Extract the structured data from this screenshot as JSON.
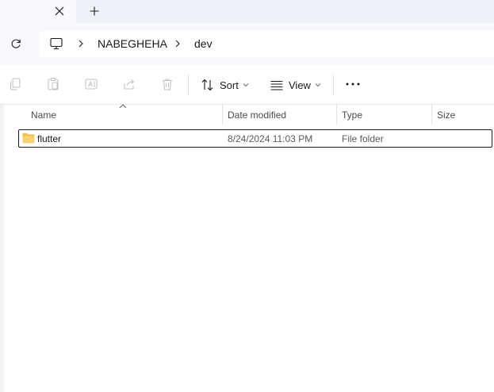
{
  "tabbar": {
    "close_icon": "close-icon",
    "new_tab_icon": "plus-icon"
  },
  "address": {
    "refresh_icon": "refresh-icon",
    "location_icon": "this-pc-icon",
    "breadcrumbs": [
      "NABEGHEHA",
      "dev"
    ]
  },
  "toolbar": {
    "icons": [
      "copy-icon",
      "paste-icon",
      "rename-icon",
      "share-icon",
      "delete-icon"
    ],
    "sort_label": "Sort",
    "view_label": "View",
    "more_icon": "more-icon"
  },
  "columns": {
    "name": "Name",
    "date": "Date modified",
    "type": "Type",
    "size": "Size"
  },
  "files": [
    {
      "name": "flutter",
      "date": "8/24/2024 11:03 PM",
      "type": "File folder",
      "size": "",
      "icon": "folder-icon"
    }
  ],
  "colors": {
    "tabbar_bg": "#eef2f8",
    "addressbar_bg": "#f7f9fc",
    "folder": "#f2c14e",
    "selection_border": "#1a1a1a"
  }
}
